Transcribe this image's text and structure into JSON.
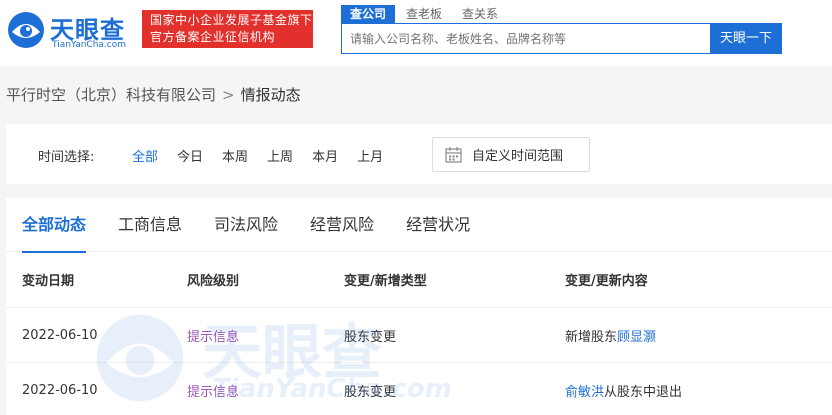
{
  "header": {
    "logo_text": "天眼查",
    "logo_sub": "TianYanCha.com",
    "badge_line1": "国家中小企业发展子基金旗下",
    "badge_line2": "官方备案企业征信机构",
    "search_tabs": [
      "查公司",
      "查老板",
      "查关系"
    ],
    "search_placeholder": "请输入公司名称、老板姓名、品牌名称等",
    "search_button": "天眼一下"
  },
  "breadcrumb": {
    "company": "平行时空（北京）科技有限公司",
    "separator": ">",
    "current": "情报动态"
  },
  "filter": {
    "label": "时间选择:",
    "options": [
      "全部",
      "今日",
      "本周",
      "上周",
      "本月",
      "上月"
    ],
    "selected": "全部",
    "custom_range": "自定义时间范围"
  },
  "tabs": [
    "全部动态",
    "工商信息",
    "司法风险",
    "经营风险",
    "经营状况"
  ],
  "active_tab": "全部动态",
  "table": {
    "headers": [
      "变动日期",
      "风险级别",
      "变更/新增类型",
      "变更/更新内容"
    ],
    "rows": [
      {
        "date": "2022-06-10",
        "risk": "提示信息",
        "type": "股东变更",
        "content_prefix": "新增股东",
        "content_link": "顾显灏",
        "content_suffix": ""
      },
      {
        "date": "2022-06-10",
        "risk": "提示信息",
        "type": "股东变更",
        "content_prefix": "",
        "content_link": "俞敏洪",
        "content_suffix": "从股东中退出"
      }
    ]
  },
  "watermark": {
    "text": "天眼查",
    "sub": "TianYanCha.com"
  },
  "colors": {
    "brand": "#1d6fd6",
    "badge_red": "#e2302c",
    "risk_purple": "#9b59b6"
  }
}
